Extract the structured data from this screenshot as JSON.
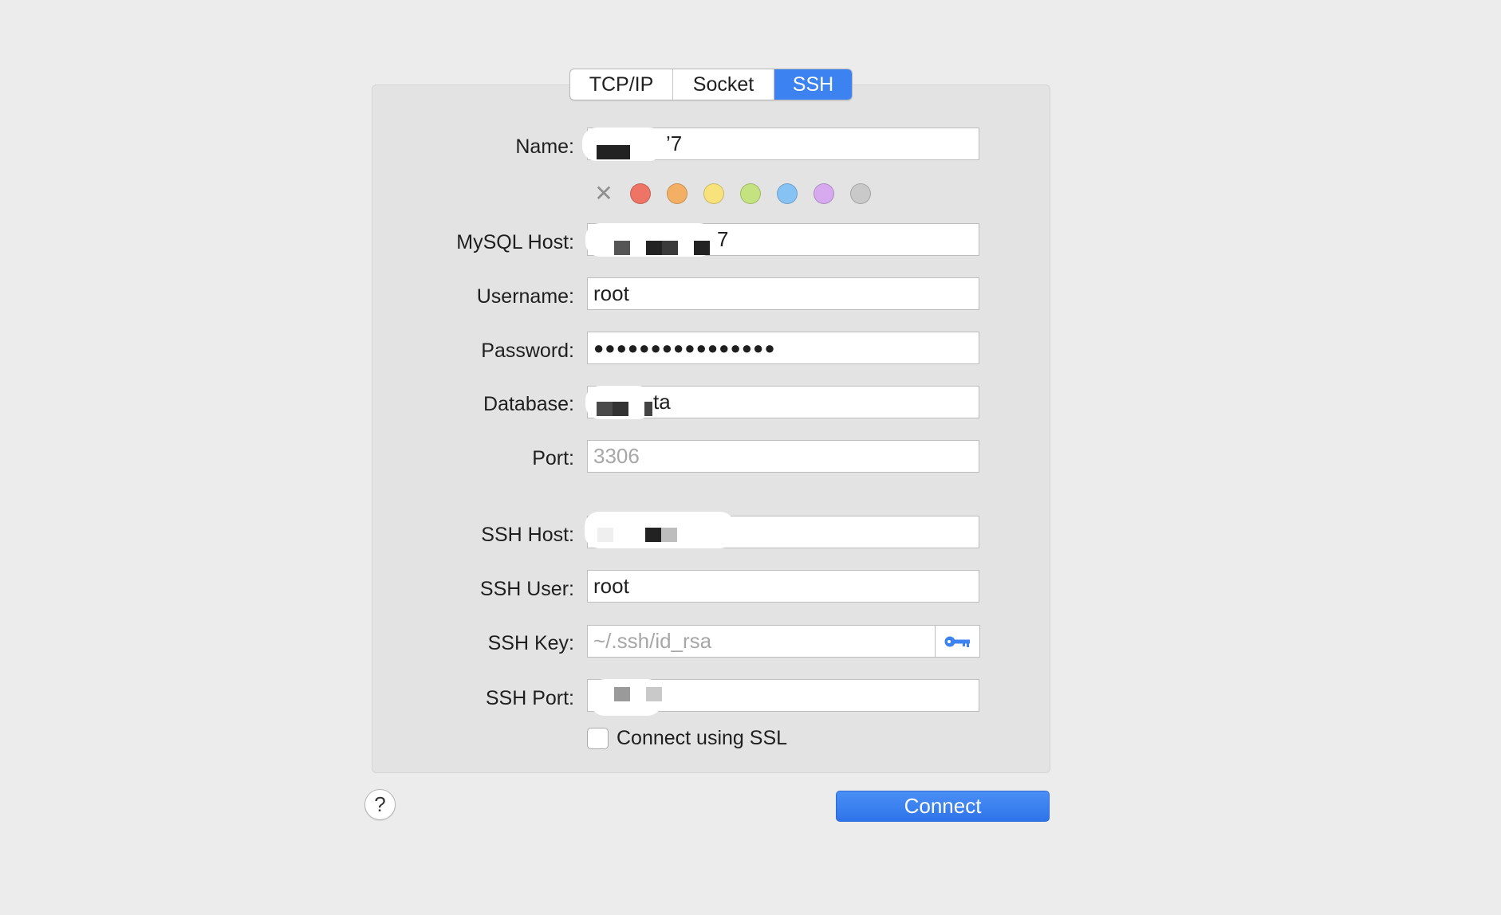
{
  "tabs": [
    {
      "label": "TCP/IP",
      "active": false
    },
    {
      "label": "Socket",
      "active": false
    },
    {
      "label": "SSH",
      "active": true
    }
  ],
  "form": {
    "name": {
      "label": "Name:",
      "value": "’7"
    },
    "mysql_host": {
      "label": "MySQL Host:",
      "value": "7"
    },
    "username": {
      "label": "Username:",
      "value": "root"
    },
    "password": {
      "label": "Password:",
      "value": "●●●●●●●●●●●●●●●●"
    },
    "database": {
      "label": "Database:",
      "value": "ta"
    },
    "port": {
      "label": "Port:",
      "placeholder": "3306"
    },
    "ssh_host": {
      "label": "SSH Host:",
      "value": ""
    },
    "ssh_user": {
      "label": "SSH User:",
      "value": "root"
    },
    "ssh_key": {
      "label": "SSH Key:",
      "placeholder": "~/.ssh/id_rsa"
    },
    "ssh_port": {
      "label": "SSH Port:",
      "value": ""
    }
  },
  "color_tags": [
    {
      "name": "red",
      "color": "#ee7566"
    },
    {
      "name": "orange",
      "color": "#f3b064"
    },
    {
      "name": "yellow",
      "color": "#f7e27b"
    },
    {
      "name": "green",
      "color": "#c4e27f"
    },
    {
      "name": "blue",
      "color": "#86c3f4"
    },
    {
      "name": "purple",
      "color": "#d7a9ee"
    },
    {
      "name": "gray",
      "color": "#c9c9c9"
    }
  ],
  "ssl": {
    "label": "Connect using SSL",
    "checked": false
  },
  "help_label": "?",
  "connect_label": "Connect",
  "colors": {
    "accent": "#3d82f1",
    "panel": "#e3e3e3",
    "background": "#ececec"
  },
  "icons": {
    "clear_color": "x-mark-icon",
    "ssh_key_browse": "key-icon",
    "help": "help-icon"
  }
}
